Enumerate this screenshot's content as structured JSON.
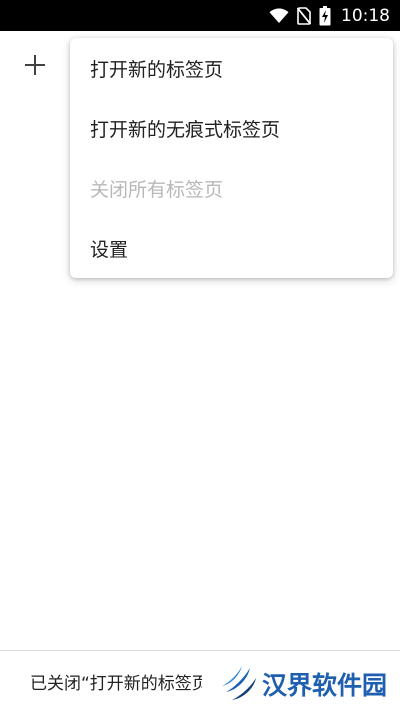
{
  "status_bar": {
    "time": "10:18",
    "icons": [
      "wifi-icon",
      "no-sim-icon",
      "battery-charging-icon"
    ]
  },
  "toolbar": {
    "add_icon": "plus-icon"
  },
  "menu": {
    "items": [
      {
        "label": "打开新的标签页",
        "enabled": true
      },
      {
        "label": "打开新的无痕式标签页",
        "enabled": true
      },
      {
        "label": "关闭所有标签页",
        "enabled": false
      },
      {
        "label": "设置",
        "enabled": true
      }
    ]
  },
  "snackbar": {
    "message": "已关闭“打开新的标签页”"
  },
  "watermark": {
    "text": "汉界软件园"
  },
  "colors": {
    "status_bar": "#000000",
    "text": "#212121",
    "disabled_text": "#b8b8b8",
    "watermark": "#1f5fb0"
  }
}
